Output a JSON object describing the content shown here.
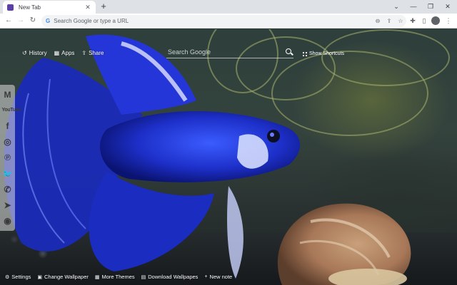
{
  "browser": {
    "tab": {
      "title": "New Tab",
      "close": "✕"
    },
    "new_tab": "+",
    "window_controls": [
      "⌄",
      "—",
      "❐",
      "✕"
    ],
    "nav": {
      "back": "←",
      "forward": "→",
      "reload": "↻"
    },
    "omnibox": {
      "google_mark": "G",
      "placeholder": "Search Google or type a URL"
    },
    "omnibox_icons": [
      "zoom-icon",
      "share-icon",
      "star-icon"
    ],
    "toolbar_icons": [
      "extensions-icon",
      "side-panel-icon",
      "profile-icon",
      "menu-icon"
    ]
  },
  "newtab": {
    "topnav": [
      {
        "icon": "history-icon",
        "glyph": "↺",
        "label": "History"
      },
      {
        "icon": "apps-icon",
        "glyph": "▦",
        "label": "Apps"
      },
      {
        "icon": "share-icon",
        "glyph": "⇪",
        "label": "Share"
      }
    ],
    "search": {
      "placeholder": "Search Google"
    },
    "shortcuts": {
      "label": "Show Shortcuts"
    },
    "social": [
      {
        "name": "gmail",
        "glyph": "M"
      },
      {
        "name": "youtube",
        "glyph": "YouTube"
      },
      {
        "name": "facebook",
        "glyph": "f"
      },
      {
        "name": "instagram",
        "glyph": "◎"
      },
      {
        "name": "pinterest",
        "glyph": "℗"
      },
      {
        "name": "twitter",
        "glyph": "🐦"
      },
      {
        "name": "whatsapp",
        "glyph": "✆"
      },
      {
        "name": "telegram",
        "glyph": "➤"
      },
      {
        "name": "reddit",
        "glyph": "◉"
      }
    ],
    "bottom": [
      {
        "icon": "gear-icon",
        "glyph": "⚙",
        "label": "Settings"
      },
      {
        "icon": "wallpaper-icon",
        "glyph": "▣",
        "label": "Change Wallpaper"
      },
      {
        "icon": "themes-icon",
        "glyph": "▦",
        "label": "More Themes"
      },
      {
        "icon": "download-icon",
        "glyph": "▤",
        "label": "Download Wallpapes"
      },
      {
        "icon": "plus-icon",
        "glyph": "+",
        "label": "New note"
      }
    ]
  }
}
